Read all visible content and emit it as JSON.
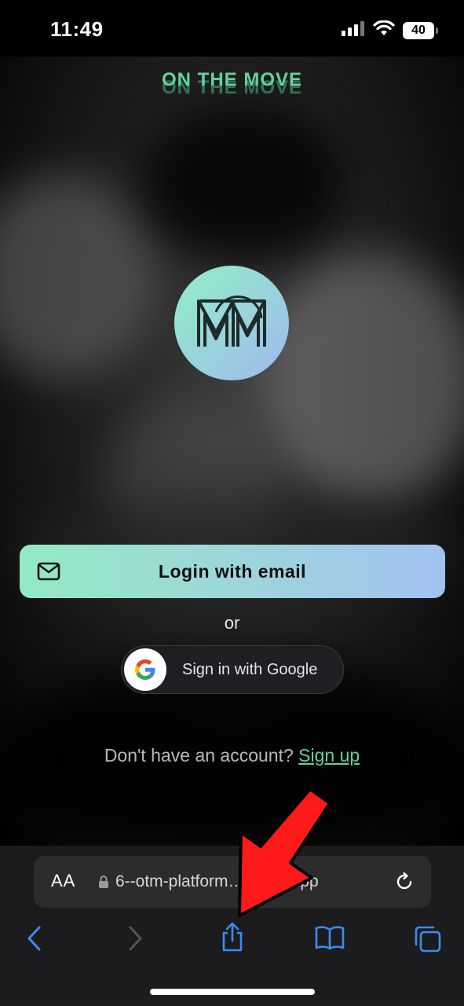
{
  "status_bar": {
    "time": "11:49",
    "battery": "40"
  },
  "page": {
    "brand": "ON THE MOVE",
    "login_email_label": "Login with email",
    "or_text": "or",
    "google_label": "Sign in with Google",
    "signup_prompt": "Don't have an account?",
    "signup_link": "Sign up"
  },
  "browser": {
    "text_size_label": "AA",
    "url": "6--otm-platform…netlify.app"
  },
  "colors": {
    "brand_green": "#5fd49a",
    "button_gradient_start": "#93eac4",
    "button_gradient_end": "#a2c2f0",
    "safari_blue": "#3b8cf0",
    "annotation_red": "#ff1a1a"
  }
}
